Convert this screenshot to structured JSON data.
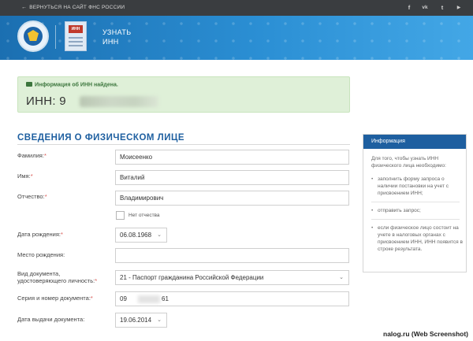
{
  "topbar": {
    "back_label": "ВЕРНУТЬСЯ НА САЙТ ФНС РОССИИ",
    "social": [
      {
        "icon": "facebook-icon",
        "glyph": "f"
      },
      {
        "icon": "vk-icon",
        "glyph": "vk"
      },
      {
        "icon": "twitter-icon",
        "glyph": "t"
      },
      {
        "icon": "youtube-icon",
        "glyph": "▶"
      }
    ]
  },
  "header": {
    "title_line1": "УЗНАТЬ",
    "title_line2": "ИНН",
    "doc_badge": "ИНН"
  },
  "alert": {
    "message": "Информация об ИНН найдена.",
    "inn_label": "ИНН: 9"
  },
  "form": {
    "section_title": "СВЕДЕНИЯ О ФИЗИЧЕСКОМ ЛИЦЕ",
    "required_mark": "*",
    "fields": [
      {
        "label": "Фамилия:",
        "value": "Моисеенко"
      },
      {
        "label": "Имя:",
        "value": "Виталий"
      },
      {
        "label": "Отчество:",
        "value": "Владимирович"
      },
      {
        "label": "Дата рождения:",
        "value": "06.08.1968"
      },
      {
        "label": "Место рождения:",
        "value": ""
      },
      {
        "label_line1": "Вид документа,",
        "label_line2": "удостоверяющего личность:",
        "value": "21 - Паспорт гражданина Российской Федерации"
      },
      {
        "label": "Серия и номер документа:",
        "value_start": "09",
        "value_end": "61"
      },
      {
        "label": "Дата выдачи документа:",
        "value": "19.06.2014"
      }
    ],
    "no_patronymic_label": "Нет отчества"
  },
  "sidebar": {
    "title": "Информация",
    "intro": "Для того, чтобы узнать ИНН физического лица необходимо:",
    "items": [
      "заполнить форму запроса о наличии постановки на учет с присвоением ИНН;",
      "отправить запрос;",
      "если физическое лицо состоит на учете в налоговых органах с присвоением ИНН, ИНН появится в строке результата."
    ]
  },
  "credit": "nalog.ru (Web Screenshot)",
  "colors": {
    "topbar": "#3a3d40",
    "header_blue": "#2b8fd4",
    "accent_blue": "#1e5fa0",
    "success_bg": "#dff0d8",
    "required_red": "#d9534f"
  }
}
